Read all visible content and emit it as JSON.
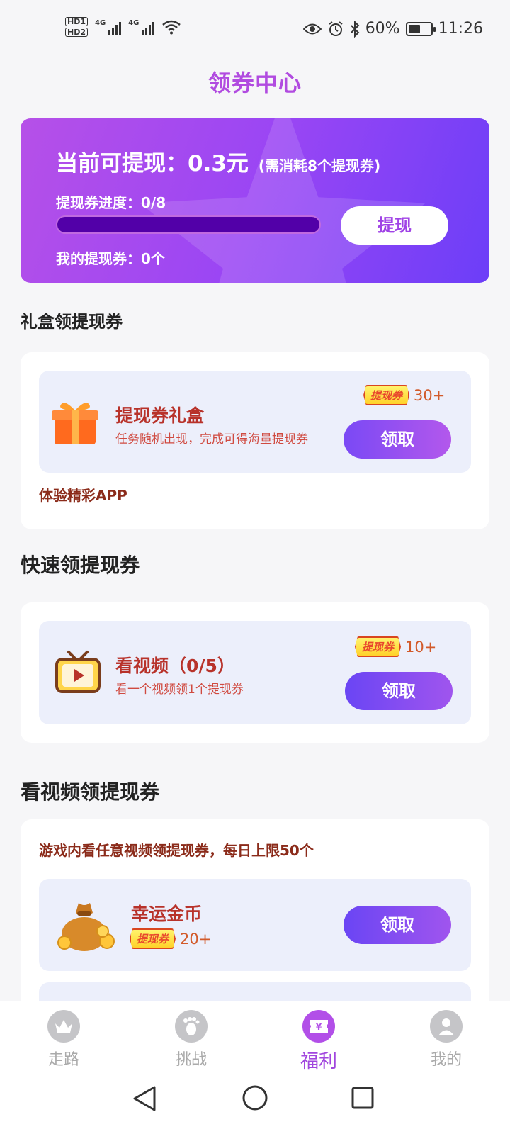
{
  "status_bar": {
    "hd1": "HD1",
    "hd2": "HD2",
    "net1": "4G",
    "net2": "4G",
    "battery_pct": "60%",
    "time": "11:26",
    "battery_level": 0.6
  },
  "page_title": "领券中心",
  "banner": {
    "withdraw_label": "当前可提现：0.3元",
    "withdraw_note": "(需消耗8个提现券)",
    "progress_label": "提现券进度：0/8",
    "progress_value": 0,
    "progress_max": 8,
    "my_coupons": "我的提现券：0个",
    "withdraw_button": "提现"
  },
  "section_gift": {
    "title": "礼盒领提现券",
    "task": {
      "name": "提现券礼盒",
      "desc": "任务随机出现，完成可得海量提现券",
      "coupon_tag": "提现券",
      "reward": "30+",
      "button": "领取"
    },
    "link": "体验精彩APP"
  },
  "section_quick": {
    "title": "快速领提现券",
    "task": {
      "name": "看视频（0/5）",
      "desc": "看一个视频领1个提现券",
      "coupon_tag": "提现券",
      "reward": "10+",
      "button": "领取"
    }
  },
  "section_video": {
    "title": "看视频领提现券",
    "notice": "游戏内看任意视频领提现券，每日上限50个",
    "task": {
      "name": "幸运金币",
      "coupon_tag": "提现券",
      "reward": "20+",
      "button": "领取"
    }
  },
  "bottom_nav": [
    {
      "label": "走路",
      "icon": "crown-icon"
    },
    {
      "label": "挑战",
      "icon": "footprint-icon"
    },
    {
      "label": "福利",
      "icon": "ticket-icon",
      "active": true
    },
    {
      "label": "我的",
      "icon": "user-icon"
    }
  ],
  "colors": {
    "accent": "#a146de",
    "banner_start": "#b650e8",
    "banner_end": "#6c3ef8",
    "task_title": "#b8322a"
  }
}
